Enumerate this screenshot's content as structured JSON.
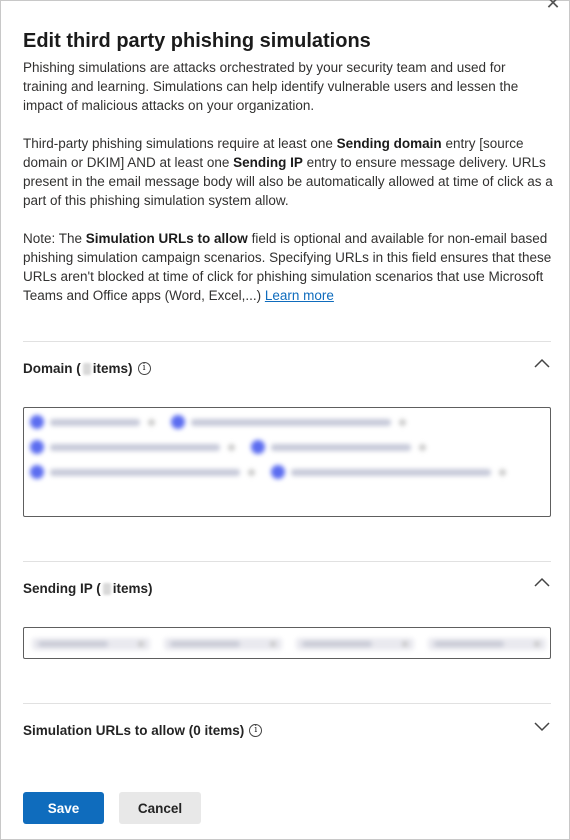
{
  "panel": {
    "title": "Edit third party phishing simulations",
    "close_icon": "close-icon"
  },
  "description": {
    "p1": "Phishing simulations are attacks orchestrated by your security team and used for training and learning. Simulations can help identify vulnerable users and lessen the impact of malicious attacks on your organization.",
    "p2_a": "Third-party phishing simulations require at least one ",
    "p2_b": "Sending domain",
    "p2_c": " entry [source domain or DKIM] AND at least one ",
    "p2_d": "Sending IP",
    "p2_e": " entry to ensure message delivery. URLs present in the email message body will also be automatically allowed at time of click as a part of this phishing simulation system allow.",
    "p3_a": "Note: The ",
    "p3_b": "Simulation URLs to allow",
    "p3_c": " field is optional and available for non-email based phishing simulation campaign scenarios. Specifying URLs in this field ensures that these URLs aren't blocked at time of click for phishing simulation scenarios that use Microsoft Teams and Office apps (Word, Excel,...) ",
    "learn_more": "Learn more"
  },
  "sections": {
    "domain": {
      "label_a": "Domain (",
      "label_b": " items)",
      "expanded": true
    },
    "sending_ip": {
      "label_a": "Sending IP (",
      "label_b": " items)",
      "expanded": true
    },
    "urls": {
      "label": "Simulation URLs to allow (0 items)",
      "expanded": false
    }
  },
  "buttons": {
    "save": "Save",
    "cancel": "Cancel"
  },
  "colors": {
    "accent": "#0f6cbd",
    "chip_avatar": "#5b6cf0"
  }
}
